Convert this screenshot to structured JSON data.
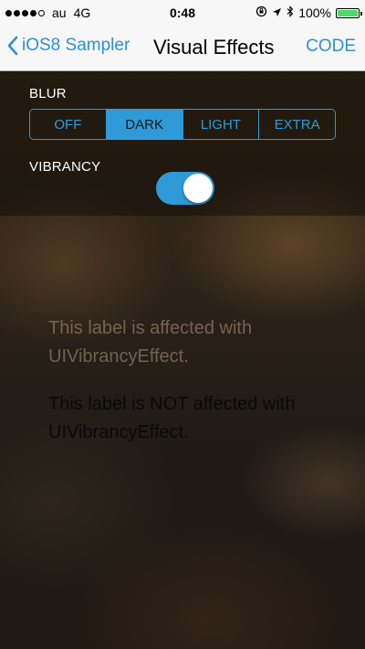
{
  "status_bar": {
    "carrier": "au",
    "network": "4G",
    "time": "0:48",
    "battery": "100%",
    "battery_level": 1.0,
    "signal_bars_filled": 4,
    "signal_bars_total": 5
  },
  "nav": {
    "back_label": "iOS8 Sampler",
    "title": "Visual Effects",
    "code_label": "CODE"
  },
  "controls": {
    "blur_label": "BLUR",
    "blur_options": [
      "OFF",
      "DARK",
      "LIGHT",
      "EXTRA"
    ],
    "blur_selected": "DARK",
    "vibrancy_label": "VIBRANCY",
    "vibrancy_on": true
  },
  "labels": {
    "vibrant_text": "This label is affected with UIVibrancyEffect.",
    "plain_text": "This label is NOT affected with UIVibrancyEffect."
  },
  "colors": {
    "accent": "#2f9ad8",
    "battery_green": "#4cd964"
  }
}
